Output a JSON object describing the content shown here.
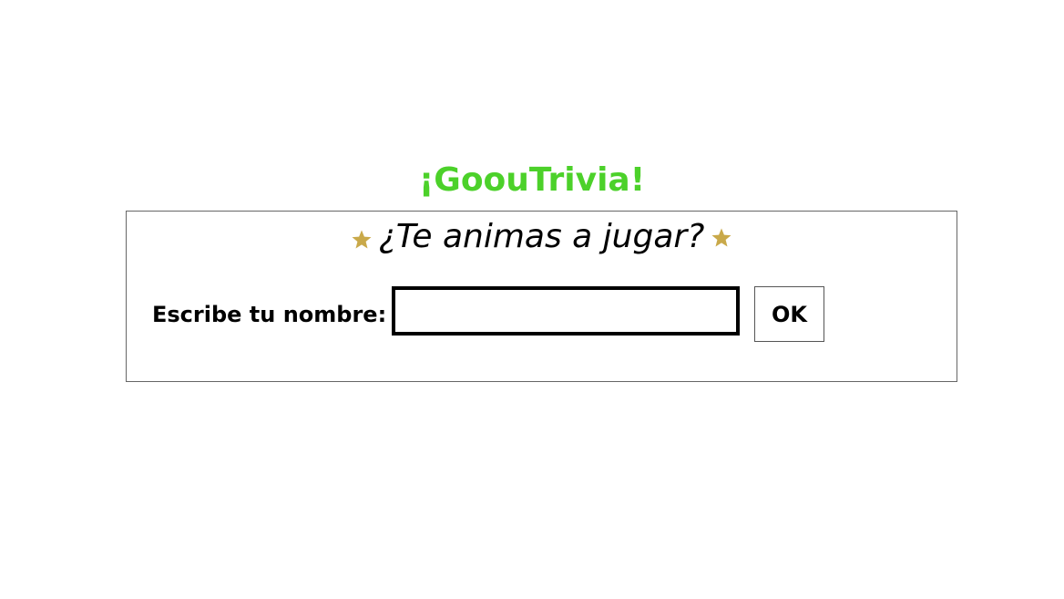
{
  "app": {
    "title": "¡GoouTrivia!",
    "title_color": "#4cd12a"
  },
  "prompt": {
    "question": "¿Te animas a jugar?",
    "decoration_icon": "star-icon",
    "decoration_color": "#c9a94a"
  },
  "form": {
    "name_label": "Escribe tu nombre:",
    "name_value": "",
    "name_placeholder": "",
    "submit_label": "OK"
  }
}
